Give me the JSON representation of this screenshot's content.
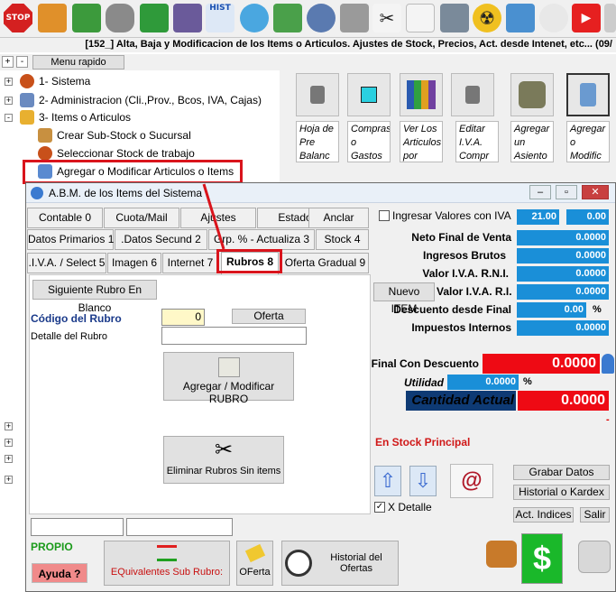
{
  "toolbar": {
    "stop_label": "STOP",
    "hist_label": "HIST"
  },
  "window_title": "[152_] Alta, Baja y Modificacion de los Items o Articulos. Ajustes de Stock, Precios, Act. desde Intenet, etc... (09/",
  "menu": {
    "expand_all": "+",
    "collapse_all": "-",
    "quick_menu_label": "Menu rapido"
  },
  "tree": {
    "items": [
      {
        "label": "1- Sistema"
      },
      {
        "label": "2- Administracion (Cli.,Prov., Bcos, IVA, Cajas)"
      },
      {
        "label": "3- Items o Articulos"
      },
      {
        "label": "Crear Sub-Stock o Sucursal"
      },
      {
        "label": "Seleccionar Stock de trabajo"
      },
      {
        "label": "Agregar o Modificar Articulos o Items"
      }
    ]
  },
  "quick_buttons": [
    {
      "label": "Hoja de Pre Balanc"
    },
    {
      "label": "Compras o Gastos"
    },
    {
      "label": "Ver Los Articulos por"
    },
    {
      "label": "Editar I.V.A. Compr"
    },
    {
      "label": "Agregar un Asiento"
    },
    {
      "label": "Agregar o Modific"
    }
  ],
  "dialog": {
    "title": "A.B.M. de los Items del Sistema",
    "tabs_row1": [
      "Contable 0",
      "Cuota/Mail",
      "Ajustes",
      "Estado",
      "Anclar"
    ],
    "tabs_row2": [
      "Datos Primarios 1",
      ".Datos Secund 2",
      "Grp. % - Actualiza 3",
      "Stock 4"
    ],
    "tabs_row3": [
      ".I.V.A. / Select 5",
      "Imagen 6",
      "Internet 7",
      "Rubros 8",
      "Oferta Gradual 9"
    ],
    "active_tab": "Rubros 8",
    "next_blank_button": "Siguiente Rubro En Blanco",
    "codigo_label": "Código del Rubro",
    "codigo_value": "0",
    "oferta_button": "Oferta",
    "detalle_label": "Detalle del Rubro",
    "detalle_value": "",
    "add_modify_button": "Agregar / Modificar RUBRO",
    "delete_button": "Eliminar Rubros Sin items",
    "iva_checkbox_label": "Ingresar Valores con IVA",
    "iva_rate": "21.00",
    "iva_extra": "0.00",
    "summary": [
      {
        "label": "Neto Final de Venta",
        "value": "0.0000"
      },
      {
        "label": "Ingresos Brutos",
        "value": "0.0000"
      },
      {
        "label": "Valor I.V.A. R.N.I.",
        "value": "0.0000"
      },
      {
        "label": "Valor I.V.A. R.I.",
        "value": "0.0000"
      },
      {
        "label": "Descuento desde Final",
        "value": "0.00"
      },
      {
        "label": "Impuestos Internos",
        "value": "0.0000"
      }
    ],
    "percent_sign": "%",
    "nuevo_item_button": "Nuevo ITEM",
    "final_con_descuento_label": "Final Con Descuento",
    "final_con_descuento_value": "0.0000",
    "utilidad_label": "Utilidad",
    "utilidad_value": "0.0000",
    "cantidad_actual_label": "Cantidad Actual",
    "cantidad_actual_value": "0.0000",
    "dash": "-",
    "stock_principal": "En Stock Principal",
    "x_detalle_label": "X Detalle",
    "grabar_button": "Grabar Datos",
    "historial_kardex_button": "Historial o Kardex",
    "act_indices_button": "Act. Indices",
    "salir_button": "Salir",
    "propio_label": "PROPIO",
    "ayuda_button": "Ayuda ?",
    "equivalentes_button": "EQuivalentes Sub Rubro:",
    "oferta_bottom_button": "OFerta",
    "historial_ofertas_button": "Historial del Ofertas",
    "bottom_field1": "",
    "bottom_field2": ""
  }
}
